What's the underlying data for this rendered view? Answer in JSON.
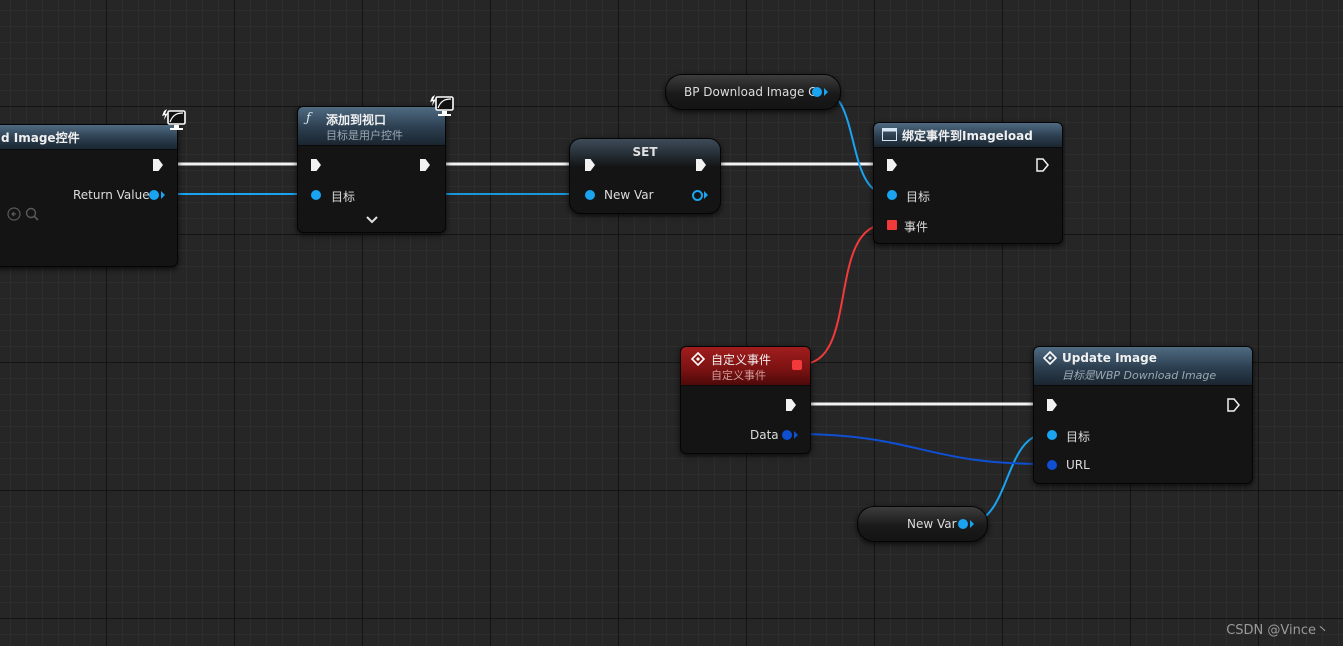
{
  "nodes": {
    "create_widget": {
      "title": "d Image控件",
      "return_value": "Return Value"
    },
    "add_to_viewport": {
      "title": "添加到视口",
      "subtitle": "目标是用户控件",
      "target": "目标"
    },
    "set": {
      "title": "SET",
      "new_var": "New Var"
    },
    "bp_download": {
      "label": "BP Download Image C"
    },
    "bind_event": {
      "title": "绑定事件到Imageload",
      "target": "目标",
      "event": "事件"
    },
    "custom_event": {
      "title": "自定义事件",
      "subtitle": "自定义事件",
      "data": "Data"
    },
    "update_image": {
      "title": "Update Image",
      "subtitle": "目标是WBP Download Image",
      "target": "目标",
      "url": "URL"
    },
    "new_var_getter": {
      "label": "New Var"
    }
  },
  "colors": {
    "exec": "#f2f2f2",
    "object": "#1aa3f0",
    "string": "#0f4fd1",
    "delegate": "#f23a3a"
  },
  "watermark": "CSDN @Vince丶"
}
